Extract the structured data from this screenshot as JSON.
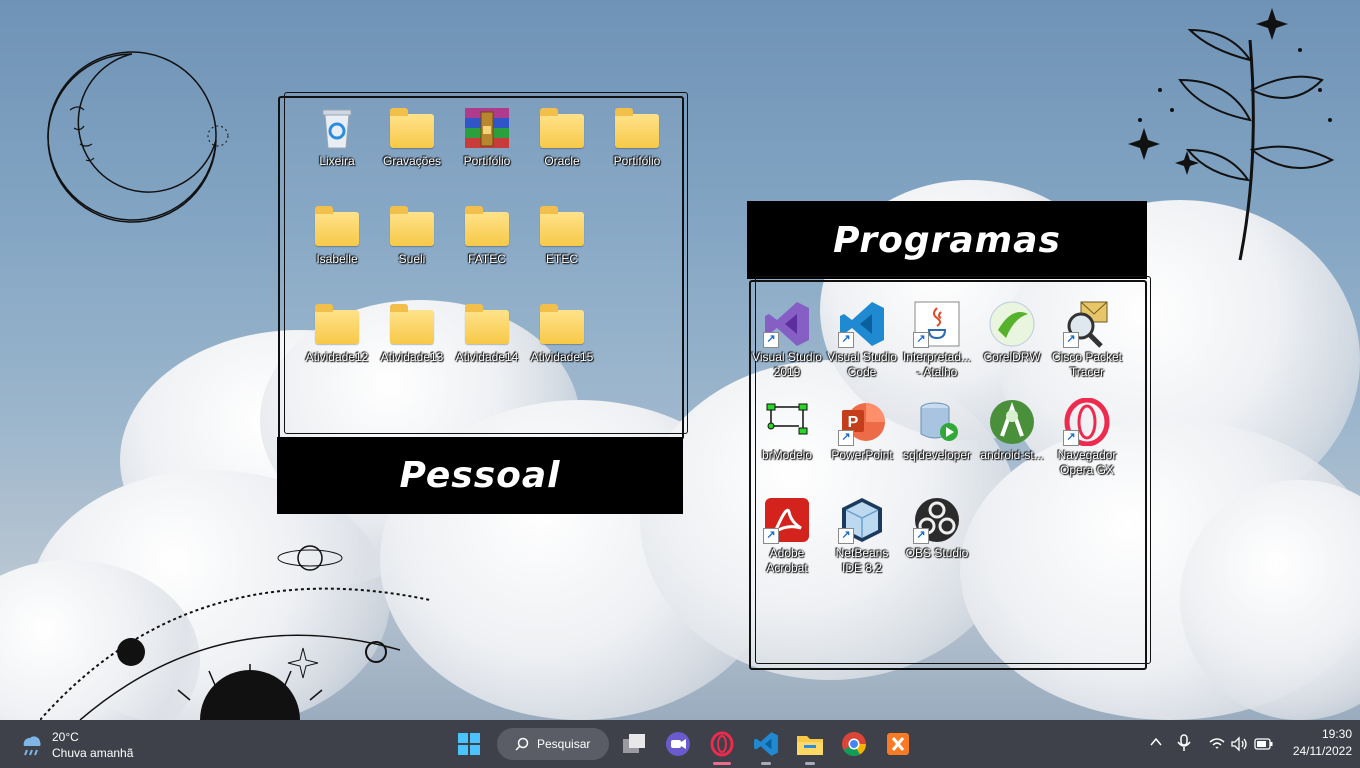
{
  "desktop": {
    "panels": {
      "pessoal": {
        "title": "Pessoal"
      },
      "programas": {
        "title": "Programas"
      }
    },
    "pessoal_icons": [
      {
        "label": "Lixeira",
        "icon": "recycle-bin-icon"
      },
      {
        "label": "Gravações",
        "icon": "folder-icon"
      },
      {
        "label": "Portifólio",
        "icon": "winrar-archive-icon"
      },
      {
        "label": "Oracle",
        "icon": "folder-icon"
      },
      {
        "label": "Portifólio",
        "icon": "folder-icon"
      },
      {
        "label": "Isabelle",
        "icon": "folder-icon"
      },
      {
        "label": "Sueli",
        "icon": "folder-icon"
      },
      {
        "label": "FATEC",
        "icon": "folder-icon"
      },
      {
        "label": "ETEC",
        "icon": "folder-icon"
      },
      {
        "label": "Atividade12",
        "icon": "folder-icon"
      },
      {
        "label": "Atividade13",
        "icon": "folder-icon"
      },
      {
        "label": "Atividade14",
        "icon": "folder-icon"
      },
      {
        "label": "Atividade15",
        "icon": "folder-icon"
      }
    ],
    "programas_icons": [
      {
        "label": "Visual Studio 2019",
        "icon": "visual-studio-icon"
      },
      {
        "label": "Visual Studio Code",
        "icon": "vscode-icon"
      },
      {
        "label": "Interpretad... - Atalho",
        "icon": "java-icon"
      },
      {
        "label": "CorelDRW",
        "icon": "coreldraw-icon"
      },
      {
        "label": "Cisco Packet Tracer",
        "icon": "cisco-packet-tracer-icon"
      },
      {
        "label": "brModelo",
        "icon": "brmodelo-icon"
      },
      {
        "label": "PowerPoint",
        "icon": "powerpoint-icon"
      },
      {
        "label": "sqldeveloper",
        "icon": "sqldeveloper-icon"
      },
      {
        "label": "android-st...",
        "icon": "android-studio-icon"
      },
      {
        "label": "Navegador Opera GX",
        "icon": "opera-gx-icon"
      },
      {
        "label": "Adobe Acrobat",
        "icon": "adobe-acrobat-icon"
      },
      {
        "label": "NetBeans IDE 8.2",
        "icon": "netbeans-icon"
      },
      {
        "label": "OBS Studio",
        "icon": "obs-studio-icon"
      }
    ]
  },
  "taskbar": {
    "weather": {
      "temp": "20°C",
      "desc": "Chuva amanhã",
      "icon": "rain-cloud-icon"
    },
    "search_label": "Pesquisar",
    "pinned": [
      {
        "name": "start-button",
        "icon": "windows-start-icon"
      },
      {
        "name": "task-view-button",
        "icon": "task-view-icon"
      },
      {
        "name": "meet-button",
        "icon": "video-chat-icon"
      },
      {
        "name": "opera-gx-taskbar",
        "icon": "opera-gx-icon"
      },
      {
        "name": "vscode-taskbar",
        "icon": "vscode-icon"
      },
      {
        "name": "file-explorer-taskbar",
        "icon": "file-explorer-icon"
      },
      {
        "name": "chrome-taskbar",
        "icon": "chrome-icon"
      },
      {
        "name": "xampp-taskbar",
        "icon": "xampp-icon"
      }
    ],
    "clock": {
      "time": "19:30",
      "date": "24/11/2022"
    },
    "colors": {
      "taskbar": "#3e4149",
      "banner": "#000000",
      "folder": "#f7c948"
    }
  }
}
